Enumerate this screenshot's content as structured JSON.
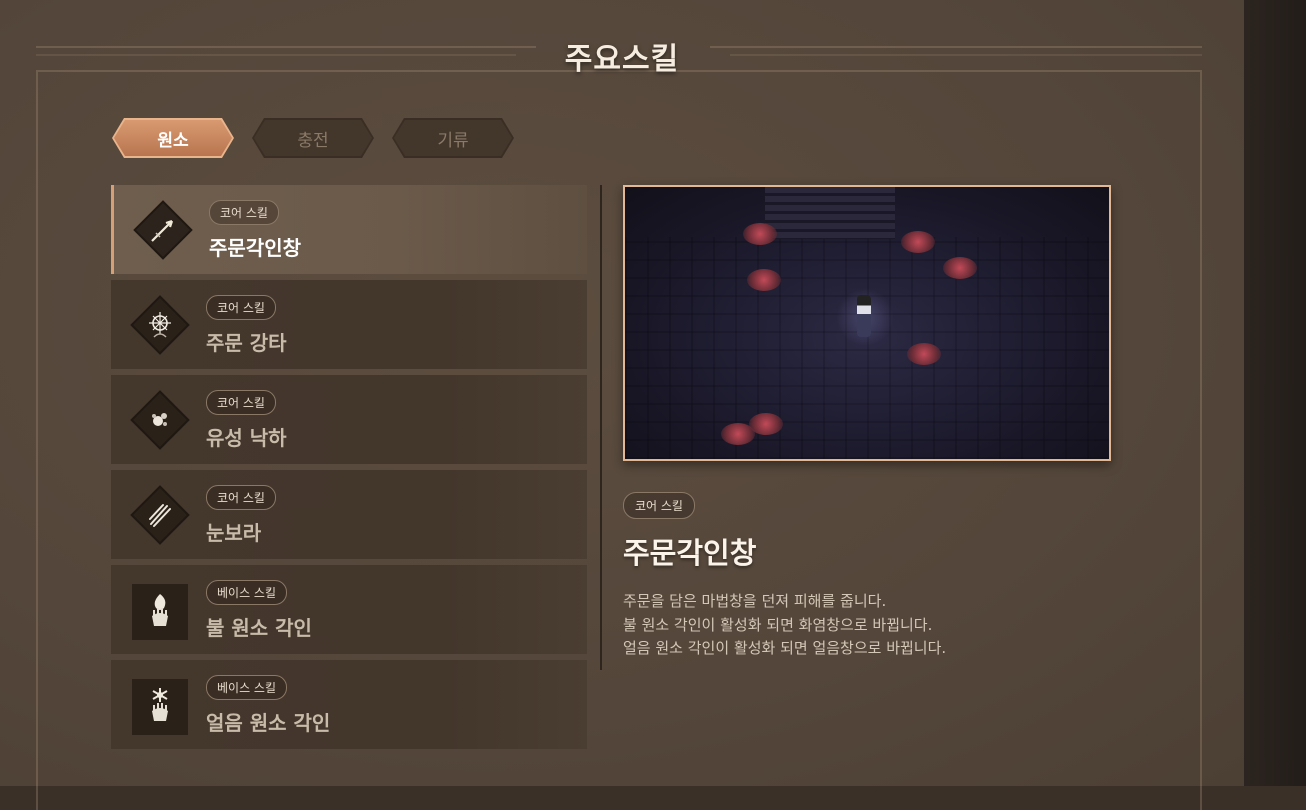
{
  "header": {
    "title": "주요스킬"
  },
  "tabs": [
    {
      "label": "원소",
      "active": true
    },
    {
      "label": "충전",
      "active": false
    },
    {
      "label": "기류",
      "active": false
    }
  ],
  "skills": [
    {
      "badge": "코어 스킬",
      "name": "주문각인창",
      "icon": "spear-icon",
      "active": true
    },
    {
      "badge": "코어 스킬",
      "name": "주문 강타",
      "icon": "star-burst-icon",
      "active": false
    },
    {
      "badge": "코어 스킬",
      "name": "유성 낙하",
      "icon": "meteor-icon",
      "active": false
    },
    {
      "badge": "코어 스킬",
      "name": "눈보라",
      "icon": "blizzard-icon",
      "active": false
    },
    {
      "badge": "베이스 스킬",
      "name": "불 원소 각인",
      "icon": "fire-hand-icon",
      "active": false
    },
    {
      "badge": "베이스 스킬",
      "name": "얼음 원소 각인",
      "icon": "ice-hand-icon",
      "active": false
    }
  ],
  "detail": {
    "badge": "코어 스킬",
    "title": "주문각인창",
    "description": [
      "주문을 담은 마법창을 던져 피해를 줍니다.",
      "불 원소 각인이 활성화 되면 화염창으로 바뀝니다.",
      "얼음 원소 각인이 활성화 되면 얼음창으로 바뀝니다."
    ]
  },
  "colors": {
    "accent": "#d4a07a",
    "panel": "#54463a",
    "active_tab": "#c98660"
  }
}
